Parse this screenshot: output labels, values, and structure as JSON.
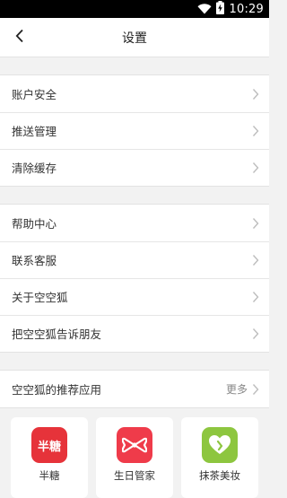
{
  "status_bar": {
    "time": "10:29",
    "wifi_icon": "wifi-icon",
    "battery_icon": "battery-charging-icon"
  },
  "header": {
    "title": "设置",
    "back_icon": "chevron-left-icon"
  },
  "groups": [
    {
      "items": [
        {
          "label": "账户安全"
        },
        {
          "label": "推送管理"
        },
        {
          "label": "清除缓存"
        }
      ]
    },
    {
      "items": [
        {
          "label": "帮助中心"
        },
        {
          "label": "联系客服"
        },
        {
          "label": "关于空空狐"
        },
        {
          "label": "把空空狐告诉朋友"
        }
      ]
    }
  ],
  "recommend": {
    "label": "空空狐的推荐应用",
    "more_label": "更多"
  },
  "apps": [
    {
      "name": "半糖",
      "icon_text": "半糖",
      "color": "#e6333a"
    },
    {
      "name": "生日管家",
      "icon_text": "",
      "color": "#ef3b4a"
    },
    {
      "name": "抹茶美妆",
      "icon_text": "",
      "color": "#8dc63f"
    }
  ],
  "colors": {
    "background": "#f2f2f2",
    "chevron": "#bdbdbd",
    "status_bar": "#000000"
  }
}
